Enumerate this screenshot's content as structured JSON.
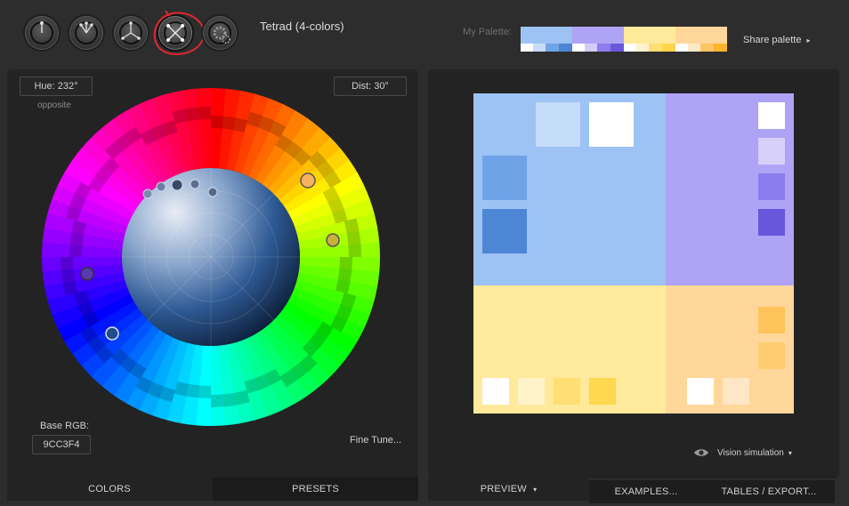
{
  "scheme": {
    "title": "Tetrad (4-colors)",
    "options": [
      "mono-icon",
      "adjacent-icon",
      "triad-icon",
      "tetrad-icon",
      "free-style-icon"
    ],
    "selected": "tetrad-icon"
  },
  "palette": {
    "label": "My Palette:",
    "share_label": "Share palette",
    "share_arrow": "▸",
    "colors": [
      {
        "main": "#9CC3F4",
        "shades": [
          "#FFFFFF",
          "#C5DCF9",
          "#70A4E9",
          "#4B85D4"
        ]
      },
      {
        "main": "#AFA3F5",
        "shades": [
          "#FFFFFF",
          "#D3CCFA",
          "#8E7DEE",
          "#6A57DA"
        ]
      },
      {
        "main": "#FFE99A",
        "shades": [
          "#FFFFFF",
          "#FFF3CB",
          "#FFDF73",
          "#FFD44A"
        ]
      },
      {
        "main": "#FFD79A",
        "shades": [
          "#FFFFFF",
          "#FFE8C6",
          "#FFC561",
          "#FFB32F"
        ]
      }
    ]
  },
  "left": {
    "hue_label": "Hue: 232°",
    "hue_mode": "opposite",
    "dist_label": "Dist: 30°",
    "base_rgb_label": "Base RGB:",
    "base_rgb_value": "9CC3F4",
    "fine_tune": "Fine Tune..."
  },
  "bottom_tabs": {
    "colors": "COLORS",
    "presets": "PRESETS",
    "preview": "PREVIEW",
    "preview_arrow": "▾",
    "examples": "EXAMPLES...",
    "tables": "TABLES / EXPORT..."
  },
  "preview": {
    "vision_label": "Vision simulation",
    "vision_arrow": "▾",
    "colors": {
      "blue": "#9CC3F4",
      "blue_light": "#C5DCF9",
      "blue_mid": "#6EA3E8",
      "blue_dark": "#4E86D6",
      "violet": "#AFA3F5",
      "violet_light": "#D6D0FB",
      "violet_mid": "#8C7CEE",
      "violet_dark": "#6A56DA",
      "yellow": "#FFE99A",
      "yellow_light": "#FFF3CA",
      "yellow_mid": "#FFDF73",
      "yellow_dark": "#FFD84F",
      "orange": "#FFD79A",
      "orange_light": "#FFE7C6",
      "orange_mid": "#FFC459",
      "orange_dark": "#FFCC72",
      "white": "#FFFFFF"
    }
  },
  "colors": {
    "accent_circle": "#e0282f",
    "panel_bg": "#232323",
    "page_bg": "#2d2d2d"
  }
}
